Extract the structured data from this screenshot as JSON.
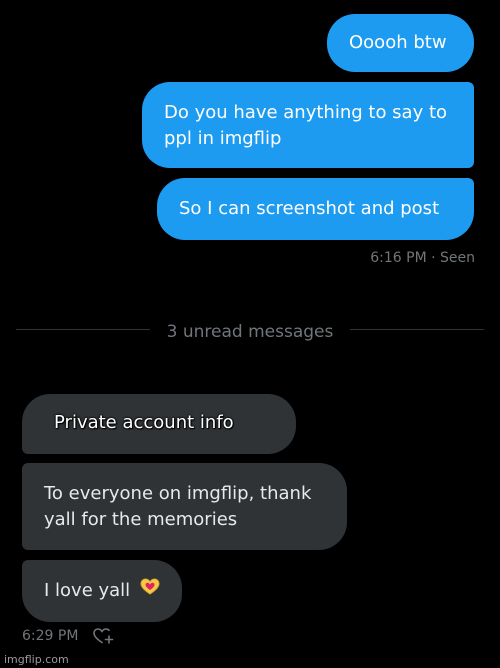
{
  "sent_messages": [
    {
      "text": "Ooooh btw"
    },
    {
      "text": "Do you have anything to say to ppl in imgflip"
    },
    {
      "text": "So I can screenshot and post"
    }
  ],
  "sent_status": "6:16 PM · Seen",
  "divider": {
    "label": "3 unread messages"
  },
  "received_messages": [
    {
      "text": "Private account info"
    },
    {
      "text": "To everyone on imgflip, thank yall for the memories"
    },
    {
      "text": "I love yall",
      "emoji_icon": "heart-hands-icon"
    }
  ],
  "received_time": "6:29 PM",
  "reaction_icon": "add-reaction-heart-icon",
  "watermark": "imgflip.com",
  "colors": {
    "sent_bubble": "#1d9bf0",
    "received_bubble": "#2f3336",
    "background": "#000000",
    "muted_text": "#71767b"
  }
}
